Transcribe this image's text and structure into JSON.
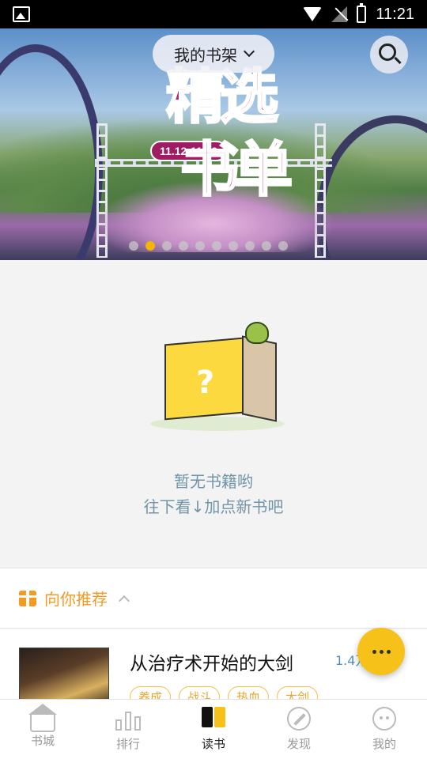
{
  "status_bar": {
    "time": "11:21"
  },
  "header": {
    "shelf_title": "我的书架"
  },
  "banner": {
    "promo_line1": "精选",
    "promo_line2": "书单",
    "dates": "11.12-11.19",
    "dot_count": 10,
    "active_dot": 1
  },
  "empty_state": {
    "line1": "暂无书籍哟",
    "line2": "往下看↓加点新书吧"
  },
  "recommend": {
    "label": "向你推荐",
    "books": [
      {
        "title": "从治疗术开始的大剑",
        "meta": "1.4万",
        "tags": [
          "养成",
          "战斗",
          "热血",
          "大剑"
        ]
      }
    ]
  },
  "bottom_nav": {
    "items": [
      {
        "label": "书城",
        "icon": "bookstore-icon"
      },
      {
        "label": "排行",
        "icon": "ranking-icon"
      },
      {
        "label": "读书",
        "icon": "reading-icon"
      },
      {
        "label": "发现",
        "icon": "compass-icon"
      },
      {
        "label": "我的",
        "icon": "profile-cat-icon"
      }
    ],
    "active_index": 2
  },
  "colors": {
    "accent": "#f6c118",
    "recommend": "#f39a22",
    "empty_text": "#7194a8",
    "promo": "#b2236f"
  }
}
